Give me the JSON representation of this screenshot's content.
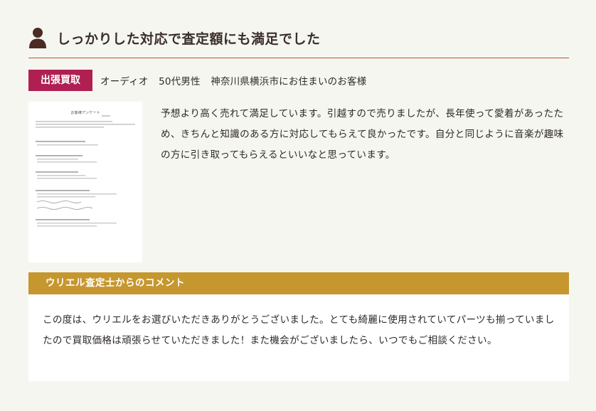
{
  "review": {
    "title": "しっかりした対応で査定額にも満足でした",
    "icon": "person-icon",
    "badge": "出張買取",
    "category": "オーディオ",
    "customer_age": "50代男性",
    "customer_location": "神奈川県横浜市にお住まいのお客様",
    "body": "予想より高く売れて満足しています。引越すので売りましたが、長年使って愛着があったため、きちんと知識のある方に対応してもらえて良かったです。自分と同じように音楽が趣味の方に引き取ってもらえるといいなと思っています。",
    "survey_image_title": "お客様アンケート"
  },
  "comment": {
    "header": "ウリエル査定士からのコメント",
    "body": "この度は、ウリエルをお選びいただきありがとうございました。とても綺麗に使用されていてパーツも揃っていましたので買取価格は頑張らせていただきました！また機会がございましたら、いつでもご相談ください。"
  },
  "colors": {
    "background": "#f6f6f1",
    "accent_rule": "#b5532c",
    "badge": "#b01f52",
    "comment_header": "#c6972e",
    "icon": "#4a2c22"
  }
}
